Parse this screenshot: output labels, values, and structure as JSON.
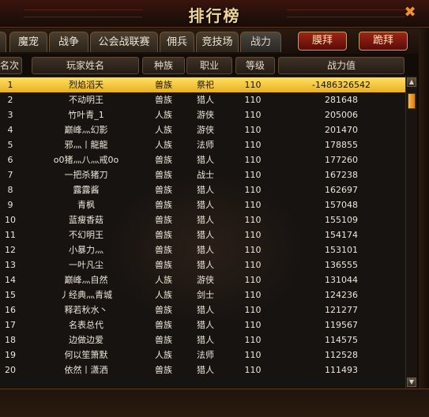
{
  "window": {
    "title": "排行榜"
  },
  "tabs": [
    {
      "label": "魔宠"
    },
    {
      "label": "战争"
    },
    {
      "label": "公会战联赛"
    },
    {
      "label": "佣兵"
    },
    {
      "label": "竞技场"
    },
    {
      "label": "战力"
    }
  ],
  "actions": {
    "worship_label": "膜拜",
    "kneel_label": "跪拜"
  },
  "columns": [
    "名次",
    "玩家姓名",
    "种族",
    "职业",
    "等级",
    "战力值"
  ],
  "rows": [
    {
      "rank": "1",
      "name": "烈焰滔天",
      "race": "兽族",
      "job": "祭祀",
      "level": "110",
      "power": "-1486326542"
    },
    {
      "rank": "2",
      "name": "不动明王",
      "race": "兽族",
      "job": "猎人",
      "level": "110",
      "power": "281648"
    },
    {
      "rank": "3",
      "name": "竹叶青_1",
      "race": "人族",
      "job": "游侠",
      "level": "110",
      "power": "205006"
    },
    {
      "rank": "4",
      "name": "巅峰灬幻影",
      "race": "人族",
      "job": "游侠",
      "level": "110",
      "power": "201470"
    },
    {
      "rank": "5",
      "name": "邪灬丨龍龍",
      "race": "人族",
      "job": "法师",
      "level": "110",
      "power": "178855"
    },
    {
      "rank": "6",
      "name": "o0猪灬八灬戒0o",
      "race": "兽族",
      "job": "猎人",
      "level": "110",
      "power": "177260"
    },
    {
      "rank": "7",
      "name": "一把杀猪刀",
      "race": "兽族",
      "job": "战士",
      "level": "110",
      "power": "167238"
    },
    {
      "rank": "8",
      "name": "露露酱",
      "race": "兽族",
      "job": "猎人",
      "level": "110",
      "power": "162697"
    },
    {
      "rank": "9",
      "name": "青枫",
      "race": "兽族",
      "job": "猎人",
      "level": "110",
      "power": "157048"
    },
    {
      "rank": "10",
      "name": "蓝瘦香菇",
      "race": "兽族",
      "job": "猎人",
      "level": "110",
      "power": "155109"
    },
    {
      "rank": "11",
      "name": "不幻明王",
      "race": "兽族",
      "job": "猎人",
      "level": "110",
      "power": "154174"
    },
    {
      "rank": "12",
      "name": "小暴力灬",
      "race": "兽族",
      "job": "猎人",
      "level": "110",
      "power": "153101"
    },
    {
      "rank": "13",
      "name": "一叶凡尘",
      "race": "兽族",
      "job": "猎人",
      "level": "110",
      "power": "136555"
    },
    {
      "rank": "14",
      "name": "巅峰灬自然",
      "race": "人族",
      "job": "游侠",
      "level": "110",
      "power": "131044"
    },
    {
      "rank": "15",
      "name": "丿经典灬青城",
      "race": "人族",
      "job": "剑士",
      "level": "110",
      "power": "124236"
    },
    {
      "rank": "16",
      "name": "释若秋水丶",
      "race": "兽族",
      "job": "猎人",
      "level": "110",
      "power": "121277"
    },
    {
      "rank": "17",
      "name": "名表总代",
      "race": "兽族",
      "job": "猎人",
      "level": "110",
      "power": "119567"
    },
    {
      "rank": "18",
      "name": "边做边爱",
      "race": "兽族",
      "job": "猎人",
      "level": "110",
      "power": "114575"
    },
    {
      "rank": "19",
      "name": "何以笙箫默",
      "race": "人族",
      "job": "法师",
      "level": "110",
      "power": "112528"
    },
    {
      "rank": "20",
      "name": "依然丨潇洒",
      "race": "兽族",
      "job": "猎人",
      "level": "110",
      "power": "111493"
    }
  ],
  "selected_row_index": 0,
  "icons": {
    "close": "close-icon",
    "scroll_up": "scroll-up-icon",
    "scroll_down": "scroll-down-icon"
  },
  "colors": {
    "highlight": "#f2c838",
    "title": "#f0d49a",
    "accent_button": "#8a1a10"
  }
}
